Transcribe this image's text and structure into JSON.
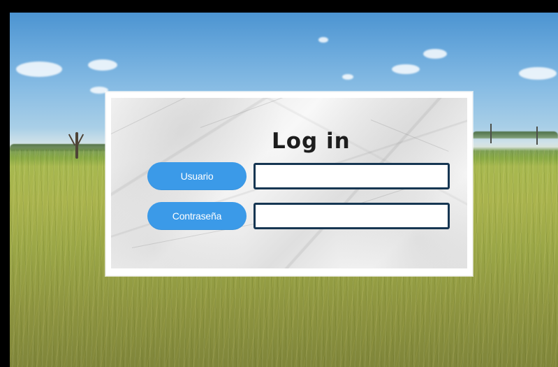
{
  "login": {
    "title": "Log in",
    "username_label": "Usuario",
    "password_label": "Contraseña",
    "username_value": "",
    "password_value": "",
    "username_placeholder": "",
    "password_placeholder": ""
  },
  "theme": {
    "frame_background": "#000000",
    "label_color": "#3b9ae8",
    "input_border_color": "#163652"
  }
}
